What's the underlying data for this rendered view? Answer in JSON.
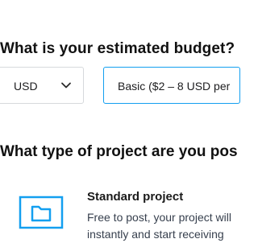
{
  "budget": {
    "heading": "What is your estimated budget?",
    "currency": "USD",
    "plan": "Basic ($2 – 8 USD per"
  },
  "project_type": {
    "heading": "What type of project are you pos",
    "options": [
      {
        "title": "Standard project",
        "description": "Free to post, your project will instantly and start receiving"
      }
    ]
  },
  "colors": {
    "accent": "#139ff0",
    "border": "#d6d9dc",
    "text": "#111111"
  }
}
